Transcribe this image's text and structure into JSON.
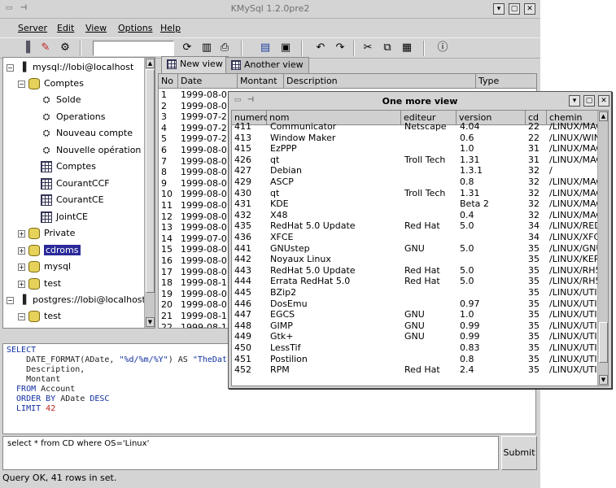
{
  "window": {
    "title": "KMySql 1.2.0pre2"
  },
  "menu": [
    "Server",
    "Edit",
    "View",
    "Options",
    "Help"
  ],
  "tree": {
    "server1": "mysql://lobi@localhost",
    "comptes_db": "Comptes",
    "solde": "Solde",
    "operations": "Operations",
    "nouveau_compte": "Nouveau compte",
    "nouvelle_operation": "Nouvelle opération",
    "t_comptes": "Comptes",
    "courant_ccf": "CourantCCF",
    "courant_ce": "CourantCE",
    "joint_ce": "JointCE",
    "private": "Private",
    "cdroms": "cdroms",
    "mysql": "mysql",
    "test": "test",
    "server2": "postgres://lobi@localhost",
    "test2": "test"
  },
  "tabs": {
    "new_view": "New view",
    "another_view": "Another view"
  },
  "main_grid": {
    "headers": [
      "No",
      "Date",
      "Montant",
      "Description",
      "Type"
    ],
    "rows": [
      [
        "1",
        "1999-08-0"
      ],
      [
        "2",
        "1999-08-0"
      ],
      [
        "3",
        "1999-07-2"
      ],
      [
        "4",
        "1999-07-2"
      ],
      [
        "5",
        "1999-07-2"
      ],
      [
        "6",
        "1999-08-0"
      ],
      [
        "7",
        "1999-08-0"
      ],
      [
        "8",
        "1999-08-0"
      ],
      [
        "9",
        "1999-08-0"
      ],
      [
        "10",
        "1999-08-0"
      ],
      [
        "11",
        "1999-08-0"
      ],
      [
        "12",
        "1999-08-0"
      ],
      [
        "13",
        "1999-08-0"
      ],
      [
        "14",
        "1999-07-0"
      ],
      [
        "15",
        "1999-08-0"
      ],
      [
        "16",
        "1999-08-0"
      ],
      [
        "17",
        "1999-08-0"
      ],
      [
        "18",
        "1999-08-1"
      ],
      [
        "19",
        "1999-08-0"
      ],
      [
        "20",
        "1999-08-0"
      ],
      [
        "21",
        "1999-08-1"
      ],
      [
        "22",
        "1999-08-1"
      ]
    ]
  },
  "sql": {
    "l1": "SELECT",
    "l2a": "    DATE_FORMAT(ADate, ",
    "l2b": "\"%d/%m/%Y\"",
    "l2c": ") AS ",
    "l2d": "\"TheDat",
    "l3": "    Description,",
    "l4": "    Montant",
    "l5a": "  FROM",
    "l5b": " Account",
    "l6a": "  ORDER BY",
    "l6b": " ADate ",
    "l6c": "DESC",
    "l7a": "  LIMIT ",
    "l7b": "42"
  },
  "query": {
    "value": "select * from CD where OS='Linux'"
  },
  "submit_label": "Submit",
  "status": "Query OK, 41 rows in set.",
  "win2": {
    "title": "One more view",
    "headers": [
      "numero",
      "nom",
      "editeur",
      "version",
      "cd",
      "chemin"
    ],
    "rows": [
      [
        "411",
        "Communicator",
        "Netscape",
        "4.04",
        "22",
        "/LINUX/MAG"
      ],
      [
        "413",
        "Window Maker",
        "",
        "0.6",
        "22",
        "/LINUX/WIND"
      ],
      [
        "415",
        "EzPPP",
        "",
        "1.0",
        "31",
        "/LINUX/MAG"
      ],
      [
        "426",
        "qt",
        "Troll Tech",
        "1.31",
        "31",
        "/LINUX/MAG"
      ],
      [
        "427",
        "Debian",
        "",
        "1.3.1",
        "32",
        "/"
      ],
      [
        "429",
        "ASCP",
        "",
        "0.8",
        "32",
        "/LINUX/MAG"
      ],
      [
        "430",
        "qt",
        "Troll Tech",
        "1.31",
        "32",
        "/LINUX/MAG"
      ],
      [
        "431",
        "KDE",
        "",
        "Beta 2",
        "32",
        "/LINUX/MAG"
      ],
      [
        "432",
        "X48",
        "",
        "0.4",
        "32",
        "/LINUX/MAG"
      ],
      [
        "435",
        "RedHat 5.0 Update",
        "Red Hat",
        "5.0",
        "34",
        "/LINUX/REDH"
      ],
      [
        "436",
        "XFCE",
        "",
        "",
        "34",
        "/LINUX/XFCE"
      ],
      [
        "441",
        "GNUstep",
        "GNU",
        "5.0",
        "35",
        "/LINUX/GNUS"
      ],
      [
        "442",
        "Noyaux Linux",
        "",
        "",
        "35",
        "/LINUX/KERN"
      ],
      [
        "443",
        "RedHat 5.0 Update",
        "Red Hat",
        "5.0",
        "35",
        "/LINUX/RH5"
      ],
      [
        "444",
        "Errata RedHat 5.0",
        "Red Hat",
        "5.0",
        "35",
        "/LINUX/RH5/E"
      ],
      [
        "445",
        "BZip2",
        "",
        "",
        "35",
        "/LINUX/UTILS"
      ],
      [
        "446",
        "DosEmu",
        "",
        "0.97",
        "35",
        "/LINUX/UTILS"
      ],
      [
        "447",
        "EGCS",
        "GNU",
        "1.0",
        "35",
        "/LINUX/UTILS"
      ],
      [
        "448",
        "GIMP",
        "GNU",
        "0.99",
        "35",
        "/LINUX/UTILS"
      ],
      [
        "449",
        "Gtk+",
        "GNU",
        "0.99",
        "35",
        "/LINUX/UTILS"
      ],
      [
        "450",
        "LessTif",
        "",
        "0.83",
        "35",
        "/LINUX/UTILS"
      ],
      [
        "451",
        "Postilion",
        "",
        "0.8",
        "35",
        "/LINUX/UTILS"
      ],
      [
        "452",
        "RPM",
        "Red Hat",
        "2.4",
        "35",
        "/LINUX/UTILS"
      ]
    ]
  }
}
